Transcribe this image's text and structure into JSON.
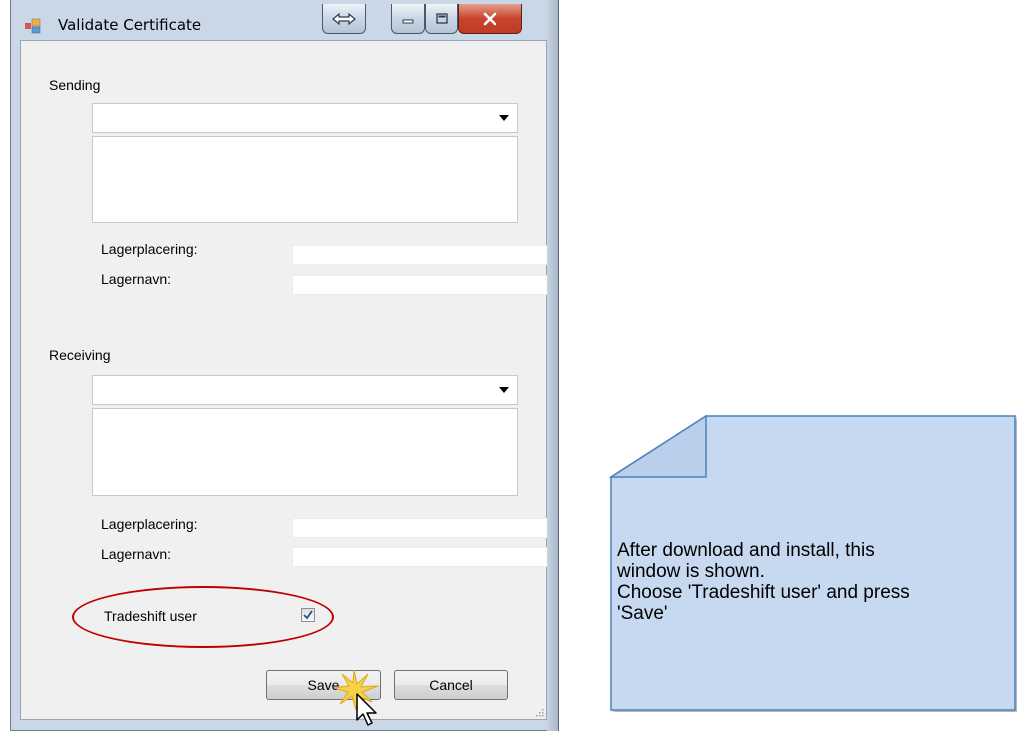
{
  "window": {
    "title": "Validate Certificate",
    "icons": {
      "app": "app-window-icon",
      "resize": "horizontal-resize-icon",
      "minimize": "minimize-icon",
      "maximize": "maximize-icon",
      "close": "close-icon"
    }
  },
  "sending": {
    "section_label": "Sending",
    "combo_value": "",
    "details_text": "",
    "lagerplacering_label": "Lagerplacering:",
    "lagerplacering_value": "",
    "lagernavn_label": "Lagernavn:",
    "lagernavn_value": ""
  },
  "receiving": {
    "section_label": "Receiving",
    "combo_value": "",
    "details_text": "",
    "lagerplacering_label": "Lagerplacering:",
    "lagerplacering_value": "",
    "lagernavn_label": "Lagernavn:",
    "lagernavn_value": ""
  },
  "tradeshift": {
    "label": "Tradeshift user",
    "checked": true
  },
  "buttons": {
    "save": "Save",
    "cancel": "Cancel"
  },
  "callout": {
    "lines": [
      "After download and install, this",
      "window is shown.",
      "Choose 'Tradeshift user' and press",
      "'Save'"
    ],
    "fill_color": "#c6d9f1",
    "border_color": "#4f81bd"
  },
  "highlight_color": "#c00000"
}
